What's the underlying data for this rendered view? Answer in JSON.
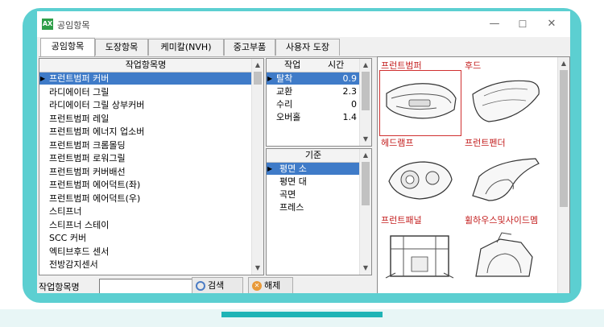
{
  "window": {
    "app_icon": "AX",
    "title": "공임항목",
    "controls": {
      "minimize": "—",
      "maximize": "☐",
      "close": "✕"
    }
  },
  "tabs": [
    {
      "label": "공임항목",
      "active": true
    },
    {
      "label": "도장항목",
      "active": false
    },
    {
      "label": "케미칼(NVH)",
      "active": false
    },
    {
      "label": "중고부품",
      "active": false
    },
    {
      "label": "사용자 도장",
      "active": false
    }
  ],
  "work_items": {
    "header": "작업항목명",
    "rows": [
      "프런트범퍼 커버",
      "라디에이터 그릴",
      "라디에이터 그릴 상부커버",
      "프런트범퍼 레일",
      "프런트범퍼 에너지 업소버",
      "프런트범퍼 크롬몰딩",
      "프런트범퍼 로워그릴",
      "프런트범퍼 커버배선",
      "프런트범퍼 에어덕트(좌)",
      "프런트범퍼 에어덕트(우)",
      "스티프너",
      "스티프너 스테이",
      "SCC 커버",
      "엑티브후드 센서",
      "전방감지센서"
    ],
    "selected_index": 0
  },
  "work_time": {
    "headers": {
      "work": "작업",
      "time": "시간"
    },
    "rows": [
      {
        "work": "탈착",
        "time": "0.9"
      },
      {
        "work": "교환",
        "time": "2.3"
      },
      {
        "work": "수리",
        "time": "0"
      },
      {
        "work": "오버홀",
        "time": "1.4"
      }
    ],
    "selected_index": 0
  },
  "standard": {
    "header": "기준",
    "rows": [
      "평면 소",
      "평면 대",
      "곡면",
      "프레스"
    ],
    "selected_index": 0
  },
  "parts": [
    {
      "label": "프런트범퍼",
      "selected": true
    },
    {
      "label": "후드",
      "selected": false
    },
    {
      "label": "헤드램프",
      "selected": false
    },
    {
      "label": "프런트펜더",
      "selected": false
    },
    {
      "label": "프런트패널",
      "selected": false
    },
    {
      "label": "휠하우스및사이드멤",
      "selected": false
    }
  ],
  "search": {
    "label": "작업항목명",
    "value": "",
    "search_button": "검색",
    "clear_button": "해제"
  },
  "colors": {
    "frame": "#5ccfd1",
    "accent_bar": "#1fb4b6",
    "selection": "#3f7bc8",
    "part_label": "#c31d1d"
  }
}
